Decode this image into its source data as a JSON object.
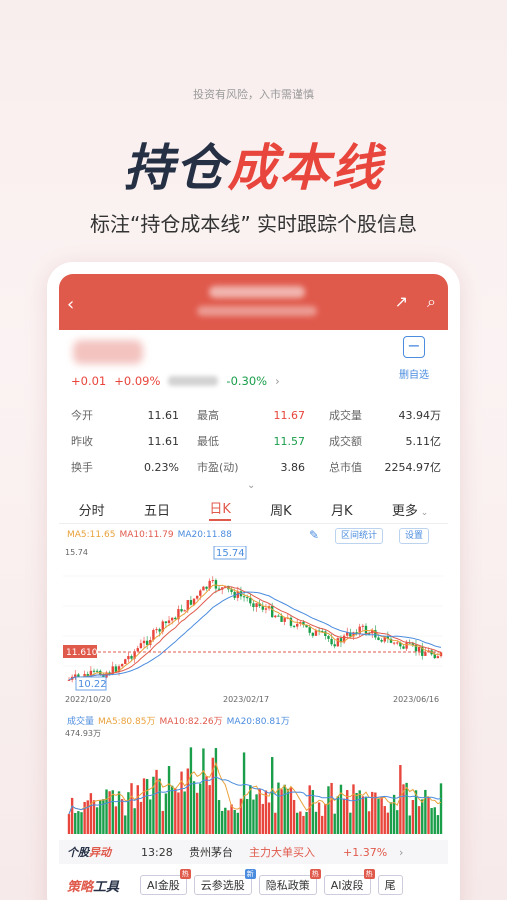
{
  "disclaimer": "投资有风险，入市需谨慎",
  "hero": {
    "dark": "持仓",
    "red": "成本线"
  },
  "subtitle": "标注“持仓成本线” 实时跟踪个股信息",
  "quote": {
    "change": "+0.01",
    "change_pct": "+0.09%",
    "index_change": "-0.30%",
    "delete_label": "删自选"
  },
  "stats": [
    [
      "今开",
      "11.61",
      "最高",
      "11.67",
      "成交量",
      "43.94万"
    ],
    [
      "昨收",
      "11.61",
      "最低",
      "11.57",
      "成交额",
      "5.11亿"
    ],
    [
      "换手",
      "0.23%",
      "市盈(动)",
      "3.86",
      "总市值",
      "2254.97亿"
    ]
  ],
  "tabs": [
    "分时",
    "五日",
    "日K",
    "周K",
    "月K",
    "更多"
  ],
  "active_tab": "日K",
  "ma": {
    "ma5": "MA5:11.65",
    "ma10": "MA10:11.79",
    "ma20": "MA20:11.88"
  },
  "buttons": {
    "range": "区间统计",
    "settings": "设置"
  },
  "chart_data": {
    "type": "candlestick",
    "y_top_label": "15.74",
    "y_bottom_label": "10.22",
    "cost_line": "11.610",
    "high_label": "15.74",
    "low_label": "10.22",
    "dates": [
      "2022/10/20",
      "2023/02/17",
      "2023/06/16"
    ],
    "volume_top_label": "474.93万",
    "volume_ma": {
      "label": "成交量",
      "ma5": "MA5:80.85万",
      "ma10": "MA10:82.26万",
      "ma20": "MA20:80.81万"
    },
    "colors": {
      "up": "#e8453c",
      "down": "#1a9e4a",
      "ma5": "#e9a13b",
      "ma10": "#e05a4c",
      "ma20": "#4b8cde"
    }
  },
  "ticker": {
    "brand_a": "个股",
    "brand_b": "异动",
    "time": "13:28",
    "name": "贵州茅台",
    "event": "主力大单买入",
    "pct": "+1.37%"
  },
  "tools": {
    "title_a": "策略",
    "title_b": "工具",
    "chips": [
      {
        "label": "AI金股",
        "tag": "热",
        "tag_color": "red"
      },
      {
        "label": "云参选股",
        "tag": "新",
        "tag_color": "blue"
      },
      {
        "label": "隐私政策",
        "tag": "热",
        "tag_color": "red"
      },
      {
        "label": "AI波段",
        "tag": "热",
        "tag_color": "red"
      },
      {
        "label": "尾",
        "tag": "",
        "tag_color": ""
      }
    ]
  }
}
